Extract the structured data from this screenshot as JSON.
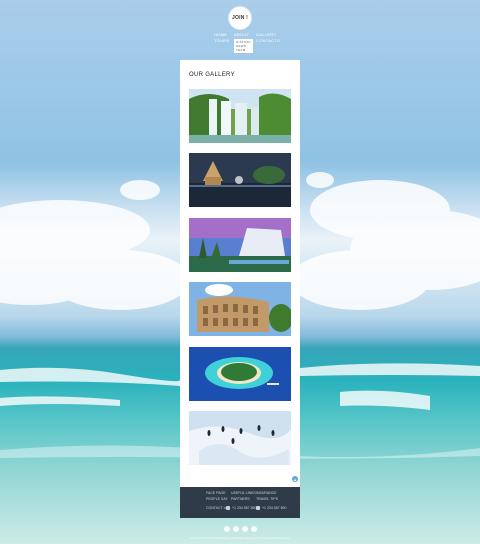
{
  "logo": {
    "text": "JOIN !"
  },
  "nav": {
    "col1": [
      "HOME",
      "TOURS"
    ],
    "col2_label": "ABOUT",
    "col2_sub": [
      "HISTORY",
      "NEWS",
      "TEAM"
    ],
    "col3": [
      "GALLERY",
      "CONTACTS"
    ]
  },
  "gallery": {
    "title": "OUR GALLERY",
    "images": [
      {
        "name": "waterfall"
      },
      {
        "name": "thai-temple"
      },
      {
        "name": "resort-hotel"
      },
      {
        "name": "colosseum"
      },
      {
        "name": "tropical-island"
      },
      {
        "name": "penguins-ice"
      }
    ]
  },
  "footer": {
    "col1": [
      "FACE PAGE",
      "PEOPLE SAY"
    ],
    "col2": [
      "USEFUL LINKS",
      "PARTNERS"
    ],
    "col3": [
      "INSURANCE",
      "TRAVEL TIPS"
    ],
    "contact_label": "CONTACT US",
    "phone1": "+1 234 567 890",
    "phone2": "+1 234 567 890"
  },
  "social": [
    "facebook",
    "twitter",
    "google-plus",
    "pinterest"
  ],
  "copyright": "Joinus © 2014 | Privacy Policy | Website designed by TemplateMonster.com",
  "colors": {
    "footer": "#2f3b48",
    "panel": "#ffffff",
    "accent": "#5aa8d8"
  }
}
